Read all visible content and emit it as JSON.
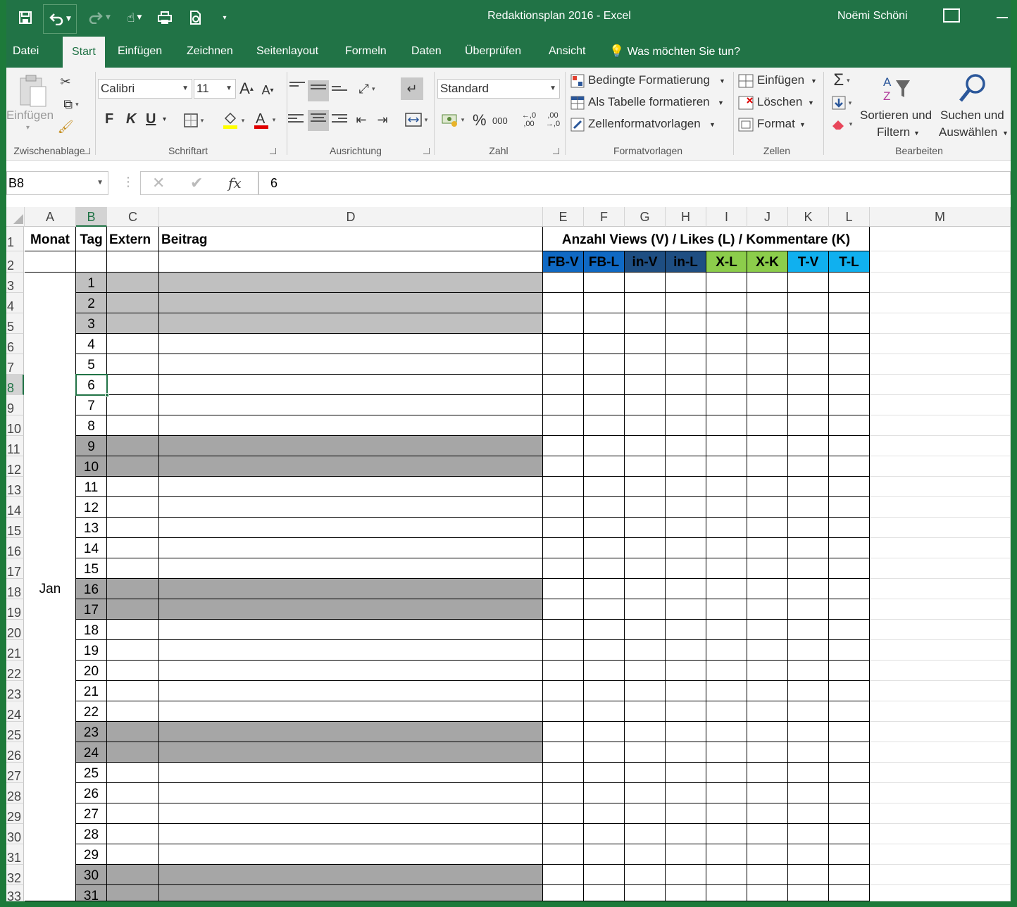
{
  "titlebar": {
    "title": "Redaktionsplan 2016 - Excel",
    "user": "Noëmi Schöni"
  },
  "tabs": [
    "Datei",
    "Start",
    "Einfügen",
    "Zeichnen",
    "Seitenlayout",
    "Formeln",
    "Daten",
    "Überprüfen",
    "Ansicht"
  ],
  "tell_me": "Was möchten Sie tun?",
  "ribbon": {
    "clipboard": {
      "paste": "Einfügen",
      "label": "Zwischenablage"
    },
    "font": {
      "name": "Calibri",
      "size": "11",
      "bold": "F",
      "italic": "K",
      "underline": "U",
      "label": "Schriftart"
    },
    "alignment": {
      "label": "Ausrichtung"
    },
    "number": {
      "format": "Standard",
      "percent": "%",
      "thousands": "000",
      "label": "Zahl"
    },
    "styles": {
      "conditional": "Bedingte Formatierung",
      "as_table": "Als Tabelle formatieren",
      "cell_styles": "Zellenformatvorlagen",
      "label": "Formatvorlagen"
    },
    "cells": {
      "insert": "Einfügen",
      "delete": "Löschen",
      "format": "Format",
      "label": "Zellen"
    },
    "editing": {
      "sort_line1": "Sortieren und",
      "sort_line2": "Filtern",
      "find_line1": "Suchen und",
      "find_line2": "Auswählen",
      "label": "Bearbeiten"
    }
  },
  "formula_bar": {
    "name_box": "B8",
    "fx": "fx",
    "value": "6"
  },
  "columns": [
    "A",
    "B",
    "C",
    "D",
    "E",
    "F",
    "G",
    "H",
    "I",
    "J",
    "K",
    "L",
    "M"
  ],
  "rows": [
    "1",
    "2",
    "3",
    "4",
    "5",
    "6",
    "7",
    "8",
    "9",
    "10",
    "11",
    "12",
    "13",
    "14",
    "15",
    "16",
    "17",
    "18",
    "19",
    "20",
    "21",
    "22",
    "23",
    "24",
    "25",
    "26",
    "27",
    "28",
    "29",
    "30",
    "31",
    "32",
    "33"
  ],
  "sheet": {
    "headers": {
      "monat": "Monat",
      "tag": "Tag",
      "extern": "Extern",
      "beitrag": "Beitrag"
    },
    "merged_header": "Anzahl Views (V) / Likes (L) / Kommentare (K)",
    "month": "Jan",
    "metrics": [
      {
        "label": "FB-V",
        "color": "#0f69c4"
      },
      {
        "label": "FB-L",
        "color": "#0f69c4"
      },
      {
        "label": "in-V",
        "color": "#1e4e82"
      },
      {
        "label": "in-L",
        "color": "#1e4e82"
      },
      {
        "label": "X-L",
        "color": "#8ccd4b"
      },
      {
        "label": "X-K",
        "color": "#8ccd4b"
      },
      {
        "label": "T-V",
        "color": "#10b0ef"
      },
      {
        "label": "T-L",
        "color": "#10b0ef"
      }
    ],
    "days": [
      "1",
      "2",
      "3",
      "4",
      "5",
      "6",
      "7",
      "8",
      "9",
      "10",
      "11",
      "12",
      "13",
      "14",
      "15",
      "16",
      "17",
      "18",
      "19",
      "20",
      "21",
      "22",
      "23",
      "24",
      "25",
      "26",
      "27",
      "28",
      "29",
      "30",
      "31"
    ],
    "shading": [
      "g1",
      "g1",
      "g1",
      "",
      "",
      "",
      "",
      "",
      "g2",
      "g2",
      "",
      "",
      "",
      "",
      "",
      "g2",
      "g2",
      "",
      "",
      "",
      "",
      "",
      "g2",
      "g2",
      "",
      "",
      "",
      "",
      "",
      "g2",
      "g2"
    ]
  }
}
